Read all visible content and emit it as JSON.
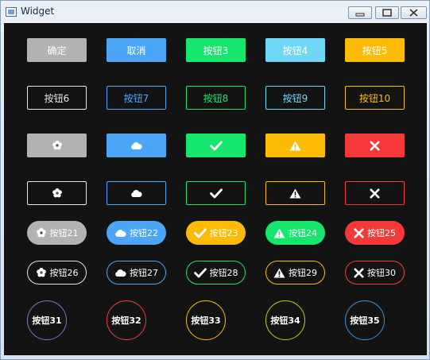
{
  "window": {
    "title": "Widget"
  },
  "colors": {
    "gray": "#b2b2b2",
    "blue": "#4ca6f7",
    "green": "#17e66d",
    "cyan": "#6fd6f6",
    "yellow": "#fcbc05",
    "red": "#f5393b",
    "background": "#131313"
  },
  "rows": [
    [
      {
        "label": "确定",
        "style": "filled",
        "color": "gray",
        "text_color": "#ffffff"
      },
      {
        "label": "取消",
        "style": "filled",
        "color": "blue",
        "text_color": "#ffffff"
      },
      {
        "label": "按钮3",
        "style": "filled",
        "color": "green",
        "text_color": "#ffffff"
      },
      {
        "label": "按钮4",
        "style": "filled",
        "color": "cyan",
        "text_color": "#ffffff"
      },
      {
        "label": "按钮5",
        "style": "filled",
        "color": "yellow",
        "text_color": "#ffffff"
      }
    ],
    [
      {
        "label": "按钮6",
        "style": "outline",
        "color": "#e6e6e6",
        "text_color": "#e6e6e6"
      },
      {
        "label": "按钮7",
        "style": "outline",
        "color": "blue",
        "text_color": "blue"
      },
      {
        "label": "按钮8",
        "style": "outline",
        "color": "green",
        "text_color": "green"
      },
      {
        "label": "按钮9",
        "style": "outline",
        "color": "cyan",
        "text_color": "cyan"
      },
      {
        "label": "按钮10",
        "style": "outline",
        "color": "yellow",
        "text_color": "yellow"
      }
    ],
    [
      {
        "label": "",
        "icon": "flower-icon",
        "style": "filled",
        "color": "gray",
        "text_color": "#ffffff"
      },
      {
        "label": "",
        "icon": "cloud-icon",
        "style": "filled",
        "color": "blue",
        "text_color": "#ffffff"
      },
      {
        "label": "",
        "icon": "check-icon",
        "style": "filled",
        "color": "green",
        "text_color": "#ffffff"
      },
      {
        "label": "",
        "icon": "warning-icon",
        "style": "filled",
        "color": "yellow",
        "text_color": "#ffffff"
      },
      {
        "label": "",
        "icon": "close-icon",
        "style": "filled",
        "color": "red",
        "text_color": "#ffffff"
      }
    ],
    [
      {
        "label": "",
        "icon": "flower-icon",
        "style": "outline",
        "color": "#e6e6e6",
        "text_color": "#ffffff"
      },
      {
        "label": "",
        "icon": "cloud-icon",
        "style": "outline",
        "color": "blue",
        "text_color": "#ffffff"
      },
      {
        "label": "",
        "icon": "check-icon",
        "style": "outline",
        "color": "green",
        "text_color": "#ffffff"
      },
      {
        "label": "",
        "icon": "warning-icon",
        "style": "outline",
        "color": "yellow",
        "text_color": "#ffffff"
      },
      {
        "label": "",
        "icon": "close-icon",
        "style": "outline",
        "color": "red",
        "text_color": "#ffffff"
      }
    ],
    [
      {
        "label": "按钮21",
        "icon": "flower-icon",
        "style": "pill",
        "color": "gray",
        "text_color": "#ffffff"
      },
      {
        "label": "按钮22",
        "icon": "cloud-icon",
        "style": "pill",
        "color": "blue",
        "text_color": "#ffffff"
      },
      {
        "label": "按钮23",
        "icon": "check-icon",
        "style": "pill",
        "color": "yellow",
        "text_color": "#ffffff"
      },
      {
        "label": "按钮24",
        "icon": "warning-icon",
        "style": "pill",
        "color": "green",
        "text_color": "#ffffff"
      },
      {
        "label": "按钮25",
        "icon": "close-icon",
        "style": "pill",
        "color": "red",
        "text_color": "#ffffff"
      }
    ],
    [
      {
        "label": "按钮26",
        "icon": "flower-icon",
        "style": "pill-outline",
        "color": "#e6e6e6",
        "text_color": "#ffffff"
      },
      {
        "label": "按钮27",
        "icon": "cloud-icon",
        "style": "pill-outline",
        "color": "blue",
        "text_color": "#ffffff"
      },
      {
        "label": "按钮28",
        "icon": "check-icon",
        "style": "pill-outline",
        "color": "green",
        "text_color": "#ffffff"
      },
      {
        "label": "按钮29",
        "icon": "warning-icon",
        "style": "pill-outline",
        "color": "yellow",
        "text_color": "#ffffff"
      },
      {
        "label": "按钮30",
        "icon": "close-icon",
        "style": "pill-outline",
        "color": "red",
        "text_color": "#ffffff"
      }
    ],
    [
      {
        "label": "按钮31",
        "style": "circle",
        "color": "#7a74c9",
        "text_color": "#ffffff"
      },
      {
        "label": "按钮32",
        "style": "circle",
        "color": "red",
        "text_color": "#ffffff"
      },
      {
        "label": "按钮33",
        "style": "circle",
        "color": "yellow",
        "text_color": "#ffffff"
      },
      {
        "label": "按钮34",
        "style": "circle",
        "color": "#c9c61a",
        "text_color": "#ffffff"
      },
      {
        "label": "按钮35",
        "style": "circle",
        "color": "#3b8fd6",
        "text_color": "#ffffff"
      }
    ]
  ]
}
